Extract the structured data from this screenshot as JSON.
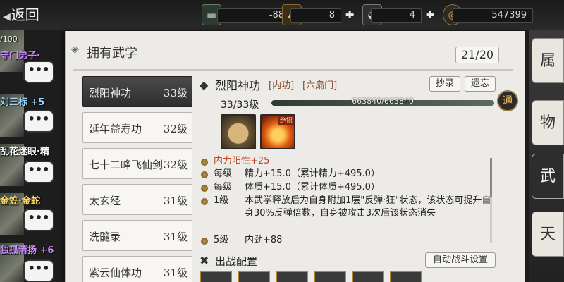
{
  "topbar": {
    "back_label": "返回",
    "resources": [
      {
        "icon": "cart-icon",
        "value": "-88",
        "color": "#9aa39a"
      },
      {
        "icon": "gold-bar-icon",
        "value": "8",
        "color": "#e6b84a"
      },
      {
        "icon": "silver-ingot-icon",
        "value": "4",
        "color": "#cfcfcf"
      },
      {
        "icon": "coin-icon",
        "value": "547399",
        "color": "#c9a25a"
      }
    ]
  },
  "characters": [
    {
      "name": "守门弟子·",
      "color": "#c98cff",
      "hp": "/100"
    },
    {
      "name": "刘三标 +5",
      "color": "#9ad7ff"
    },
    {
      "name": "乱花迷眼·精",
      "color": "#ffffff"
    },
    {
      "name": "金笠·金蛇",
      "color": "#ffd966"
    },
    {
      "name": "独孤清扬 +6",
      "color": "#c98cff"
    }
  ],
  "chat_glyph": "•••",
  "right_tabs": [
    "属",
    "物",
    "武",
    "天"
  ],
  "panel": {
    "title": "拥有武学",
    "count": "21/20"
  },
  "skills": [
    {
      "name": "烈阳神功",
      "level": "33级"
    },
    {
      "name": "延年益寿功",
      "level": "32级"
    },
    {
      "name": "七十二峰飞仙剑",
      "level": "32级"
    },
    {
      "name": "太玄经",
      "level": "31级"
    },
    {
      "name": "洗髓录",
      "level": "31级"
    },
    {
      "name": "紫云仙体功",
      "level": "31级"
    }
  ],
  "detail": {
    "title": "烈阳神功",
    "tag_type": "[内功]",
    "tag_sect": "[六扇门]",
    "copy_label": "抄录",
    "forget_label": "遗忘",
    "level": "33/33级",
    "exp_text": "663840/663840",
    "exp_fraction": 1.0,
    "tong_label": "通",
    "art_badge": "绝招",
    "effects": [
      {
        "label": "",
        "value": "内力阳性+25",
        "highlight": true
      },
      {
        "label": "每级",
        "value": "精力+15.0（累计精力+495.0）"
      },
      {
        "label": "每级",
        "value": "体质+15.0（累计体质+495.0）"
      },
      {
        "label": "1级",
        "value": "本武学释放后为自身附加1层\"反弹·狂\"状态，该状态可提升自身30%反弹倍数，自身被攻击3次后该状态消失"
      },
      {
        "label": "5级",
        "value": "内劲+88"
      }
    ],
    "battle_title": "出战配置",
    "auto_battle_label": "自动战斗设置"
  }
}
